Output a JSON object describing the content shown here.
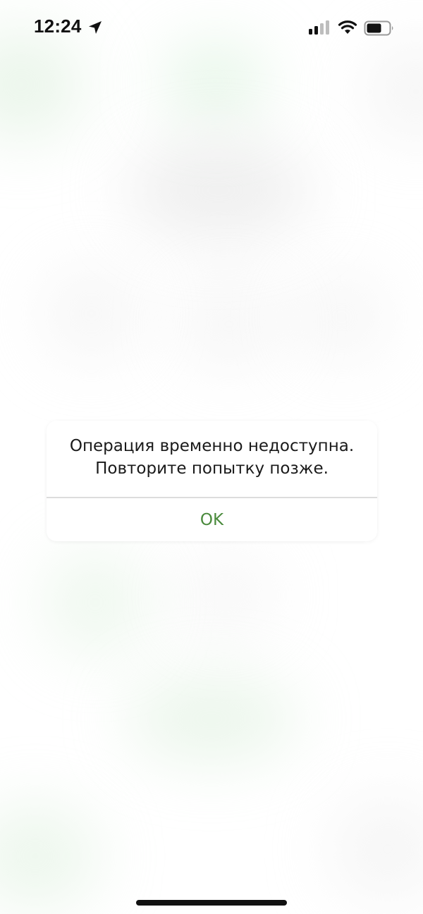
{
  "status_bar": {
    "time": "12:24",
    "icons": [
      "location-arrow-icon",
      "signal-icon",
      "wifi-icon",
      "battery-icon"
    ]
  },
  "alert": {
    "message_line1": "Операция временно недоступна.",
    "message_line2": "Повторите попытку позже.",
    "ok_label": "OK"
  },
  "colors": {
    "accent": "#4a8a3c",
    "text": "#1a1a1a",
    "divider": "#dcdcdc"
  }
}
